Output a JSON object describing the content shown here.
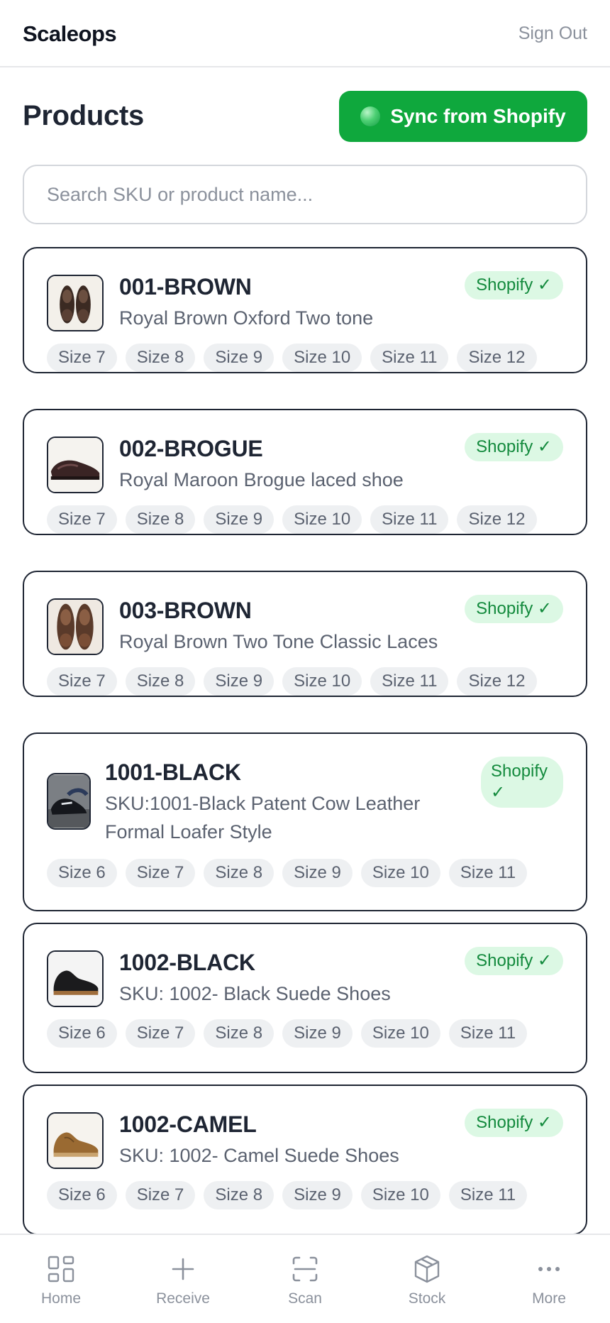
{
  "header": {
    "brand": "Scaleops",
    "sign_out": "Sign Out"
  },
  "page": {
    "title": "Products",
    "sync_label": "Sync from Shopify"
  },
  "search": {
    "placeholder": "Search SKU or product name...",
    "value": ""
  },
  "products": [
    {
      "sku": "001-BROWN",
      "name": "Royal Brown Oxford Two tone",
      "badge": "Shopify ✓",
      "image": "shoe-brown-pair-icon",
      "sizes": [
        "Size 7",
        "Size 8",
        "Size 9",
        "Size 10",
        "Size 11",
        "Size 12"
      ]
    },
    {
      "sku": "002-BROGUE",
      "name": "Royal Maroon Brogue laced shoe",
      "badge": "Shopify ✓",
      "image": "shoe-maroon-brogue-icon",
      "sizes": [
        "Size 7",
        "Size 8",
        "Size 9",
        "Size 10",
        "Size 11",
        "Size 12"
      ]
    },
    {
      "sku": "003-BROWN",
      "name": "Royal Brown Two Tone Classic Laces",
      "badge": "Shopify ✓",
      "image": "shoe-brown-classic-icon",
      "sizes": [
        "Size 7",
        "Size 8",
        "Size 9",
        "Size 10",
        "Size 11",
        "Size 12"
      ]
    },
    {
      "sku": "1001-BLACK",
      "name_line1": "SKU:1001-Black Patent Cow Leather",
      "name_line2": "Formal Loafer Style",
      "badge_line1": "Shopify",
      "badge_line2": "✓",
      "image": "shoe-black-loafer-icon",
      "sizes": [
        "Size 6",
        "Size 7",
        "Size 8",
        "Size 9",
        "Size 10",
        "Size 11"
      ]
    },
    {
      "sku": "1002-BLACK",
      "name": "SKU: 1002- Black Suede Shoes",
      "badge": "Shopify ✓",
      "image": "shoe-black-suede-icon",
      "sizes": [
        "Size 6",
        "Size 7",
        "Size 8",
        "Size 9",
        "Size 10",
        "Size 11"
      ]
    },
    {
      "sku": "1002-CAMEL",
      "name": "SKU: 1002- Camel Suede Shoes",
      "badge": "Shopify ✓",
      "image": "shoe-camel-suede-icon",
      "sizes": [
        "Size 6",
        "Size 7",
        "Size 8",
        "Size 9",
        "Size 10",
        "Size 11"
      ]
    }
  ],
  "nav": [
    {
      "label": "Home",
      "icon": "grid-icon"
    },
    {
      "label": "Receive",
      "icon": "plus-icon"
    },
    {
      "label": "Scan",
      "icon": "scan-icon"
    },
    {
      "label": "Stock",
      "icon": "box-icon"
    },
    {
      "label": "More",
      "icon": "more-dots-icon"
    }
  ],
  "colors": {
    "accent": "#0fa83d",
    "badge_bg": "#dcf8e4",
    "badge_text": "#138a3d",
    "chip_bg": "#eef0f2",
    "text": "#1e2533",
    "muted": "#8b919c"
  }
}
